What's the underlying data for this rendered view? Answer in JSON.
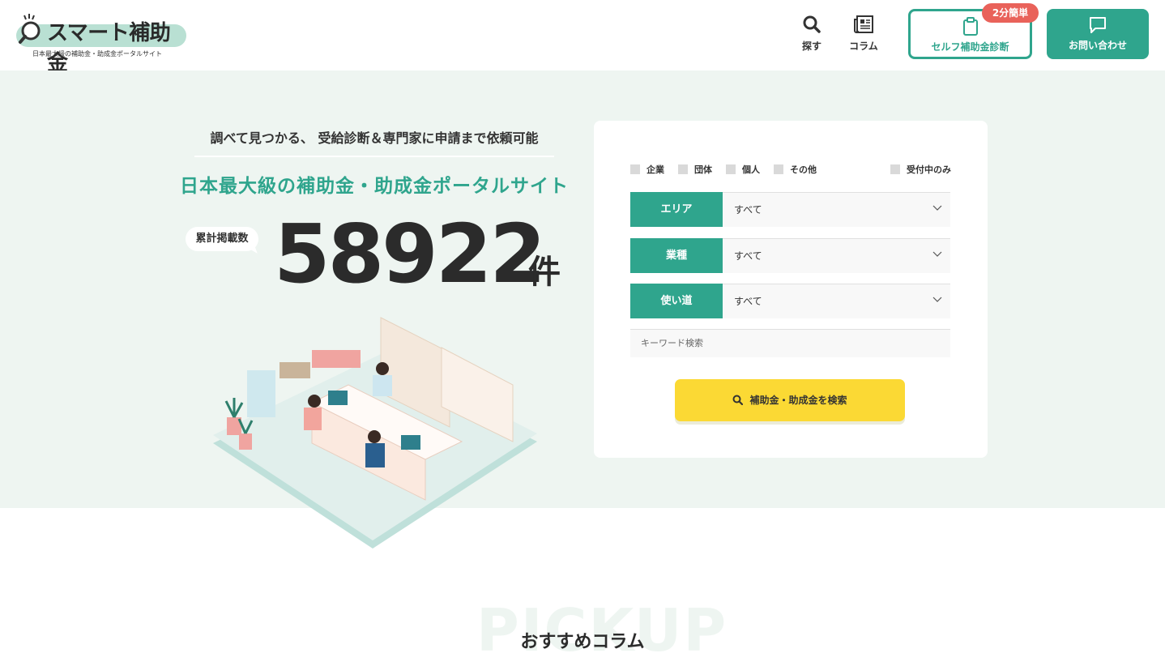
{
  "header": {
    "logo_text": "スマート補助金",
    "logo_tagline": "日本最大級の補助金・助成金ポータルサイト",
    "nav": [
      {
        "label": "探す",
        "icon": "search-icon"
      },
      {
        "label": "コラム",
        "icon": "newspaper-icon"
      }
    ],
    "self_diagnosis": {
      "label": "セルフ補助金診断",
      "badge": "2分簡単",
      "icon": "clipboard-icon"
    },
    "contact": {
      "label": "お問い合わせ",
      "icon": "chat-icon"
    }
  },
  "hero": {
    "subtitle": "調べて見つかる、 受給診断＆専門家に申請まで依頼可能",
    "headline": "日本最大級の補助金・助成金ポータルサイト",
    "count_label": "累計掲載数",
    "count_value": "58922",
    "count_unit": "件"
  },
  "search": {
    "checkboxes": [
      "企業",
      "団体",
      "個人",
      "その他"
    ],
    "accepting_only": "受付中のみ",
    "filters": [
      {
        "label": "エリア",
        "value": "すべて"
      },
      {
        "label": "業種",
        "value": "すべて"
      },
      {
        "label": "使い道",
        "value": "すべて"
      }
    ],
    "keyword_placeholder": "キーワード検索",
    "button_label": "補助金・助成金を検索"
  },
  "pickup": {
    "bg_text": "PICKUP",
    "title": "おすすめコラム"
  },
  "colors": {
    "brand_green": "#2fa58d",
    "hero_bg": "#eef5f1",
    "search_yellow": "#fbd934",
    "badge_red": "#e9625a"
  }
}
